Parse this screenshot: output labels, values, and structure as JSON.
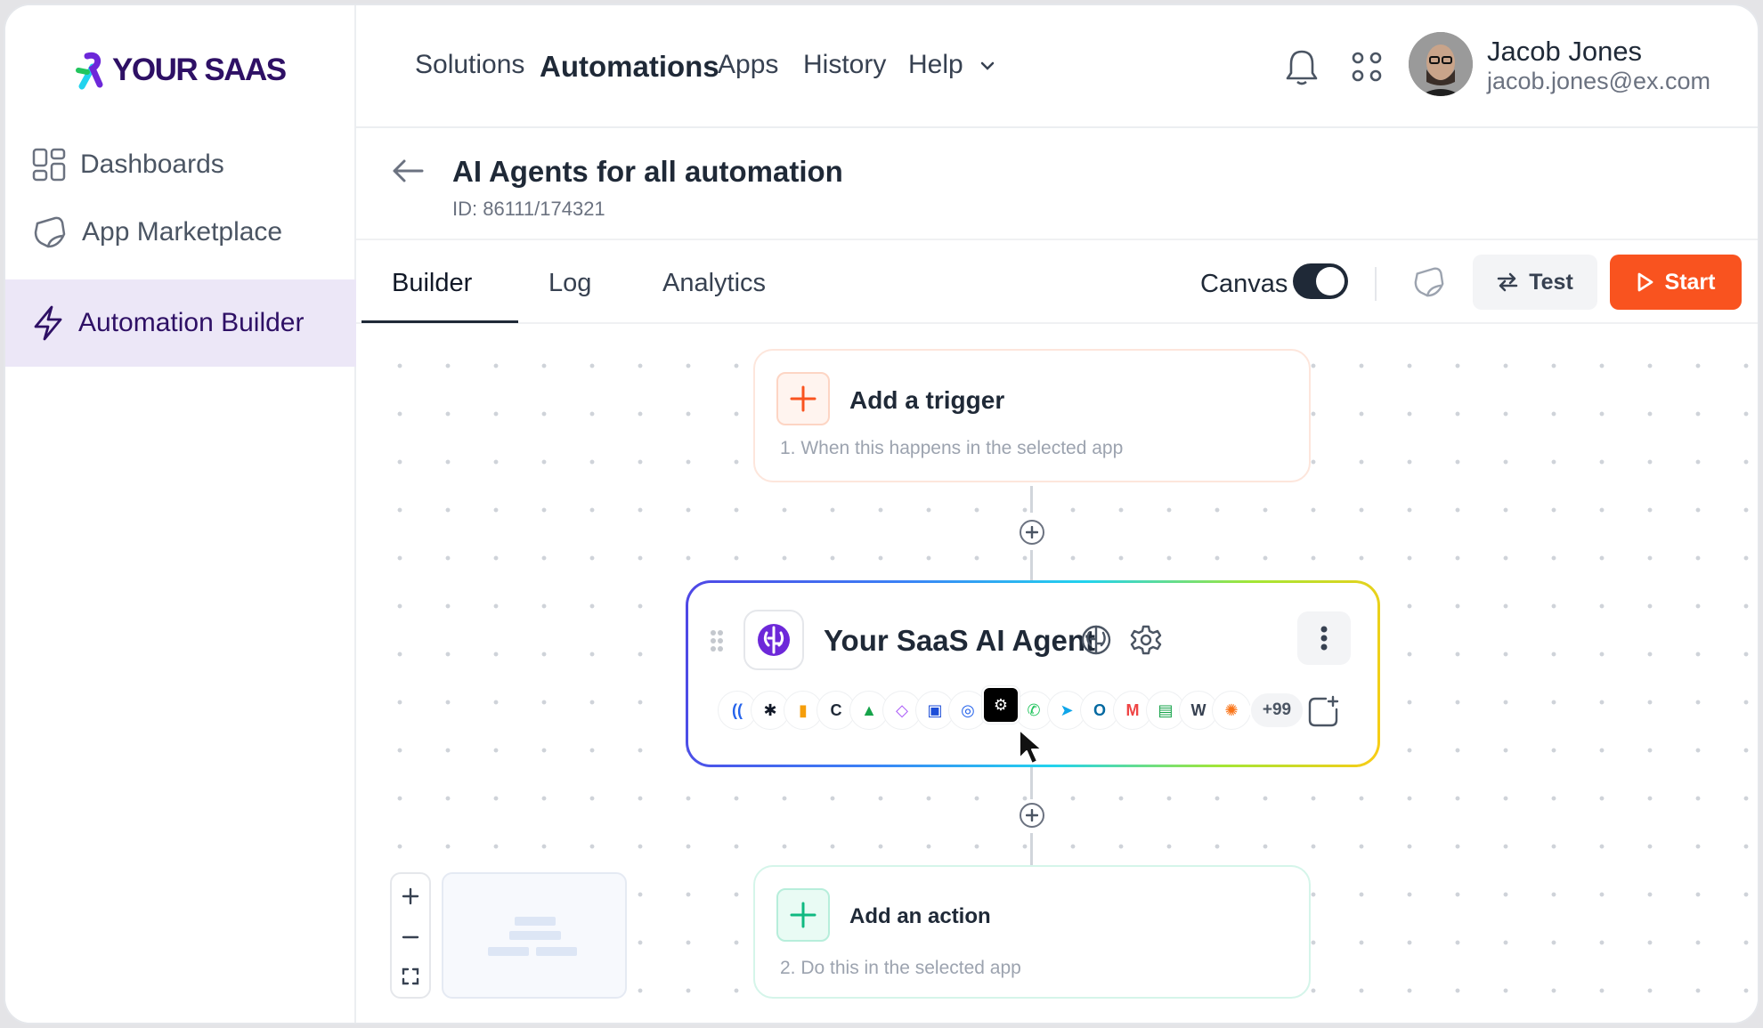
{
  "brand": {
    "name": "YOUR SAAS",
    "colors": {
      "primary": "#2e1065",
      "accent_orange": "#f9531f",
      "accent_teal": "#22d3ee"
    }
  },
  "sidebar": {
    "items": [
      {
        "label": "Dashboards",
        "icon": "grid-icon",
        "active": false
      },
      {
        "label": "App Marketplace",
        "icon": "sticker-icon",
        "active": false
      },
      {
        "label": "Automation Builder",
        "icon": "lightning-icon",
        "active": true
      }
    ]
  },
  "topnav": {
    "links": [
      {
        "label": "Solutions"
      },
      {
        "label": "Automations",
        "active": true
      },
      {
        "label": "Apps"
      },
      {
        "label": "History"
      },
      {
        "label": "Help",
        "has_dropdown": true
      }
    ],
    "icons": [
      "bell-icon",
      "apps-grid-icon"
    ]
  },
  "user": {
    "name": "Jacob Jones",
    "email": "jacob.jones@ex.com"
  },
  "page": {
    "title": "AI Agents for all automation",
    "id_text": "ID: 86111/174321"
  },
  "tabs": [
    {
      "label": "Builder",
      "active": true
    },
    {
      "label": "Log"
    },
    {
      "label": "Analytics"
    }
  ],
  "toolbar": {
    "canvas_label": "Canvas",
    "canvas_on": true,
    "test_label": "Test",
    "start_label": "Start"
  },
  "flow": {
    "trigger": {
      "title": "Add a trigger",
      "subtitle": "1. When this happens in the selected app"
    },
    "agent": {
      "title": "Your SaaS AI Agent",
      "apps": [
        {
          "name": "wave-app",
          "color": "#2563eb"
        },
        {
          "name": "asterisk-app",
          "color": "#111827"
        },
        {
          "name": "analytics-app",
          "color": "#f59e0b"
        },
        {
          "name": "dark-c-app",
          "color": "#1f2937"
        },
        {
          "name": "ads-app",
          "color": "#16a34a"
        },
        {
          "name": "clickup-app",
          "color": "#a855f7"
        },
        {
          "name": "trello-app",
          "color": "#1d4ed8"
        },
        {
          "name": "ring-app",
          "color": "#2563eb"
        },
        {
          "name": "openai-app",
          "color": "#000000"
        },
        {
          "name": "whatsapp-app",
          "color": "#22c55e"
        },
        {
          "name": "telegram-app",
          "color": "#0ea5e9"
        },
        {
          "name": "outlook-app",
          "color": "#0369a1"
        },
        {
          "name": "gmail-app",
          "color": "#ef4444"
        },
        {
          "name": "sheets-app",
          "color": "#16a34a"
        },
        {
          "name": "wordpress-app",
          "color": "#374151"
        },
        {
          "name": "hubspot-app",
          "color": "#f97316"
        }
      ],
      "more_count": "+99"
    },
    "action": {
      "title": "Add an action",
      "subtitle": "2. Do this in the selected app"
    }
  }
}
